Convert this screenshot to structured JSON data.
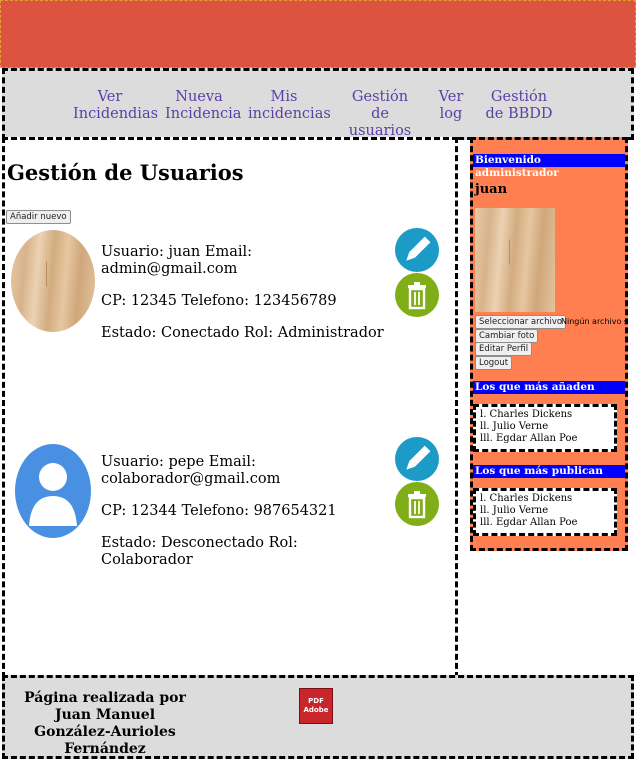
{
  "nav": {
    "items": [
      {
        "label": "Ver Incidendias"
      },
      {
        "label": "Nueva Incidencia"
      },
      {
        "label": "Mis incidencias"
      },
      {
        "label": "Gestión de usuarios"
      },
      {
        "label": "Ver log"
      },
      {
        "label": "Gestión de BBDD"
      }
    ]
  },
  "main": {
    "title": "Gestión de Usuarios",
    "add_button": "Añadir nuevo",
    "users": [
      {
        "line1": "Usuario: juan Email: admin@gmail.com",
        "line2": "CP: 12345 Telefono: 123456789",
        "line3": "Estado: Conectado Rol: Administrador"
      },
      {
        "line1": "Usuario: pepe Email: colaborador@gmail.com",
        "line2": "CP: 12344 Telefono: 987654321",
        "line3": "Estado: Desconectado Rol: Colaborador"
      }
    ]
  },
  "sidebar": {
    "welcome": "Bienvenido administrador",
    "username": "juan",
    "file_button": "Seleccionar archivo",
    "file_status": "Ningún archivo selec",
    "change_photo": "Cambiar foto",
    "edit_profile": "Editar Perfil",
    "logout": "Logout",
    "most_added_title": "Los que más añaden",
    "most_added": [
      "l. Charles Dickens",
      "ll. Julio Verne",
      "lll. Egdar Allan Poe"
    ],
    "most_published_title": "Los que más publican",
    "most_published": [
      "l. Charles Dickens",
      "ll. Julio Verne",
      "lll. Egdar Allan Poe"
    ]
  },
  "footer": {
    "credit": "Página realizada por Juan Manuel González-Aurioles Fernández",
    "pdf_icon_label": "PDF Adobe"
  }
}
